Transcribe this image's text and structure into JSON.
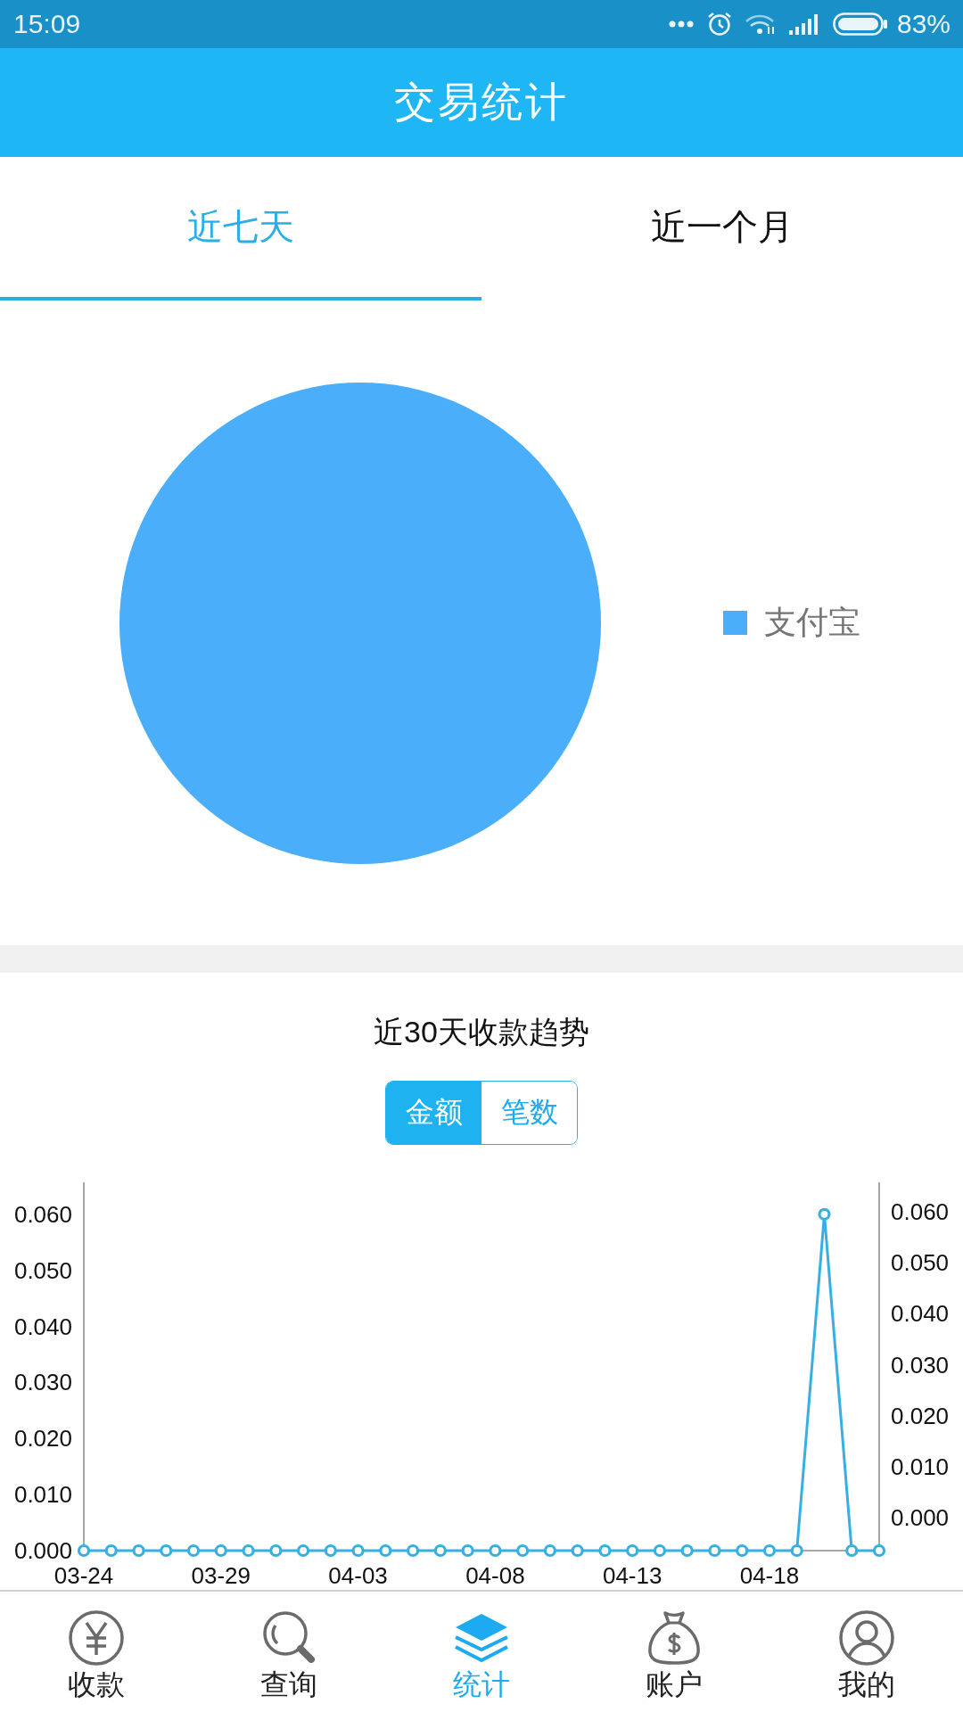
{
  "status_bar": {
    "time": "15:09",
    "battery": "83%"
  },
  "header": {
    "title": "交易统计"
  },
  "tabs": [
    {
      "label": "近七天",
      "selected": true
    },
    {
      "label": "近一个月",
      "selected": false
    }
  ],
  "share_chart": {
    "chart_data": {
      "type": "pie",
      "series": [
        {
          "name": "支付宝",
          "color": "#4aaefb",
          "values": [
            1
          ]
        }
      ]
    }
  },
  "trend": {
    "title": "近30天收款趋势",
    "toggle": [
      {
        "label": "金额",
        "selected": true
      },
      {
        "label": "笔数",
        "selected": false
      }
    ],
    "chart_data": {
      "type": "line",
      "categories": [
        "03-24",
        null,
        null,
        null,
        null,
        "03-29",
        null,
        null,
        null,
        null,
        "04-03",
        null,
        null,
        null,
        null,
        "04-08",
        null,
        null,
        null,
        null,
        "04-13",
        null,
        null,
        null,
        null,
        "04-18",
        null,
        null,
        null,
        null
      ],
      "series": [
        {
          "color": "#38afe2",
          "marker": "circle",
          "values": [
            0,
            0,
            0,
            0,
            0,
            0,
            0,
            0,
            0,
            0,
            0,
            0,
            0,
            0,
            0,
            0,
            0,
            0,
            0,
            0,
            0,
            0,
            0,
            0,
            0,
            0,
            0,
            0.06,
            0,
            0
          ]
        }
      ],
      "ylim": [
        0,
        0.0657
      ],
      "yticks": [
        {
          "value": 0,
          "label": "0.000"
        },
        {
          "value": 0.01,
          "label": "0.010"
        },
        {
          "value": 0.02,
          "label": "0.020"
        },
        {
          "value": 0.03,
          "label": "0.030"
        },
        {
          "value": 0.04,
          "label": "0.040"
        },
        {
          "value": 0.05,
          "label": "0.050"
        },
        {
          "value": 0.06,
          "label": "0.060"
        }
      ]
    },
    "right_axis": {
      "labels": [
        "0.060",
        "0.050",
        "0.040",
        "0.030",
        "0.020",
        "0.010",
        "0.000"
      ]
    }
  },
  "nav": [
    {
      "label": "收款",
      "kind": "yen",
      "selected": false
    },
    {
      "label": "查询",
      "kind": "search",
      "selected": false
    },
    {
      "label": "统计",
      "kind": "layers",
      "selected": true
    },
    {
      "label": "账户",
      "kind": "bag",
      "selected": false
    },
    {
      "label": "我的",
      "kind": "user",
      "selected": false
    }
  ]
}
